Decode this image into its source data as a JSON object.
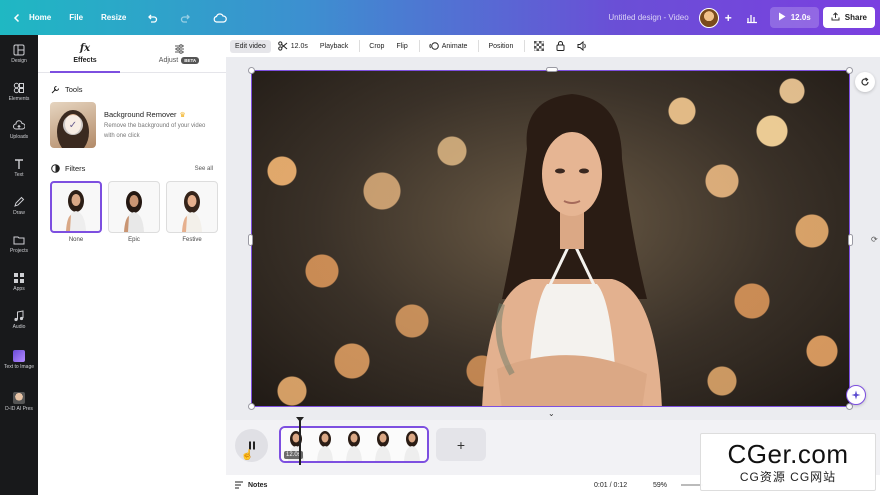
{
  "topbar": {
    "home": "Home",
    "file": "File",
    "resize": "Resize",
    "design_title": "Untitled design - Video",
    "duration": "12.0s",
    "share": "Share"
  },
  "rail": {
    "items": [
      {
        "label": "Design"
      },
      {
        "label": "Elements"
      },
      {
        "label": "Uploads"
      },
      {
        "label": "Text"
      },
      {
        "label": "Draw"
      },
      {
        "label": "Projects"
      },
      {
        "label": "Apps"
      },
      {
        "label": "Audio"
      },
      {
        "label": "Text to Image"
      },
      {
        "label": "D-ID AI Pres"
      }
    ]
  },
  "panel": {
    "tabs": [
      {
        "label": "Effects",
        "icon": "fx-icon"
      },
      {
        "label": "Adjust",
        "badge": "BETA",
        "icon": "sliders-icon"
      }
    ],
    "tools_heading": "Tools",
    "tool": {
      "title": "Background Remover",
      "description": "Remove the background of your video with one click"
    },
    "filters_heading": "Filters",
    "see_all": "See all",
    "filters": [
      {
        "label": "None"
      },
      {
        "label": "Epic"
      },
      {
        "label": "Festive"
      }
    ]
  },
  "toolbar": {
    "edit_video": "Edit video",
    "trim": "12.0s",
    "playback": "Playback",
    "crop": "Crop",
    "flip": "Flip",
    "animate": "Animate",
    "position": "Position"
  },
  "timeline": {
    "clip_time": "12.0s"
  },
  "bottombar": {
    "notes": "Notes",
    "time": "0:01 / 0:12",
    "zoom": "59%"
  },
  "watermark": {
    "main": "CGer.com",
    "sub": "CG资源 CG网站"
  },
  "colors": {
    "accent": "#7d4fe0",
    "gradient_start": "#1fb8c3",
    "gradient_end": "#7b3fe0"
  }
}
